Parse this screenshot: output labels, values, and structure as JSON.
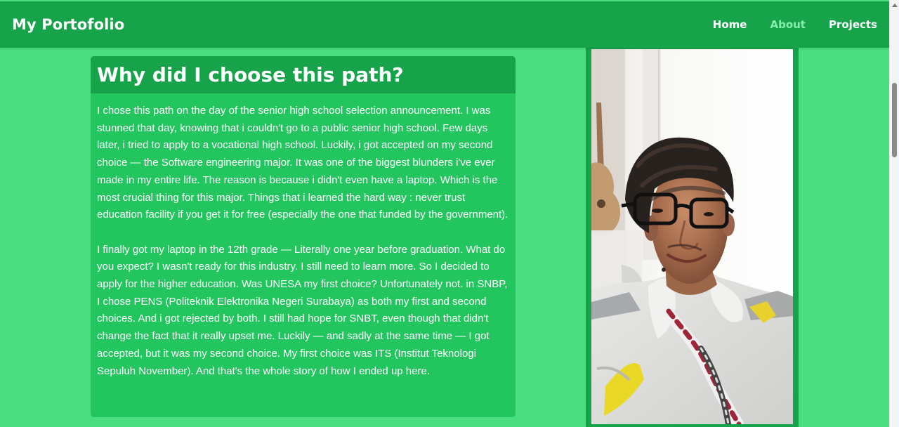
{
  "nav": {
    "brand": "My Portofolio",
    "links": [
      {
        "label": "Home",
        "state": "default"
      },
      {
        "label": "About",
        "state": "active"
      },
      {
        "label": "Projects",
        "state": "default"
      }
    ]
  },
  "article": {
    "heading": "Why did I choose this path?",
    "paragraphs": [
      "I chose this path on the day of the senior high school selection announcement. I was stunned that day, knowing that i couldn't go to a public senior high school. Few days later, i tried to apply to a vocational high school. Luckily, i got accepted on my second choice — the Software engineering major. It was one of the biggest blunders i've ever made in my entire life. The reason is because i didn't even have a laptop. Which is the most crucial thing for this major. Things that i learned the hard way : never trust education facility if you get it for free (especially the one that funded by the government).",
      "I finally got my laptop in the 12th grade — Literally one year before graduation. What do you expect? I wasn't ready for this industry. I still need to learn more. So I decided to apply for the higher education. Was UNESA my first choice? Unfortunately not. in SNBP, I chose PENS (Politeknik Elektronika Negeri Surabaya) as both my first and second choices. And i got rejected by both. I still had hope for SNBT, even though that didn't change the fact that it really upset me. Luckily — and sadly at the same time — I got accepted, but it was my second choice. My first choice was ITS (Institut Teknologi Sepuluh November). And that's the whole story of how I ended up here."
    ]
  },
  "colors": {
    "page_background": "#4ade80",
    "navbar": "#16a34a",
    "article_card": "#22c55e",
    "heading_bar": "#16a34a",
    "active_link": "#86efac",
    "text": "#ffffff"
  },
  "icons": {
    "scroll_up": "scroll-up-arrow-icon"
  }
}
